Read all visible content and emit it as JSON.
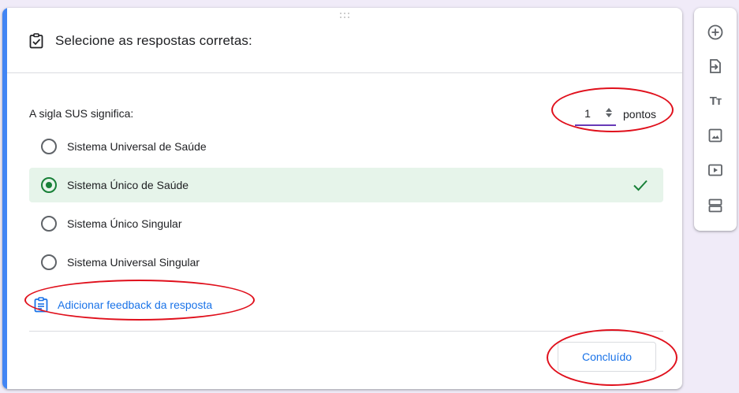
{
  "question_card": {
    "title": "Selecione as respostas corretas:",
    "question": "A sigla SUS significa:",
    "points": {
      "value": "1",
      "label": "pontos"
    },
    "options": [
      {
        "label": "Sistema Universal de Saúde",
        "selected": false,
        "correct": false
      },
      {
        "label": "Sistema Único de Saúde",
        "selected": true,
        "correct": true
      },
      {
        "label": "Sistema Único Singular",
        "selected": false,
        "correct": false
      },
      {
        "label": "Sistema Universal Singular",
        "selected": false,
        "correct": false
      }
    ],
    "feedback_link": "Adicionar feedback da resposta",
    "done_button": "Concluído"
  },
  "side_toolbar": {
    "tools": [
      {
        "icon": "add-circle-icon"
      },
      {
        "icon": "import-questions-icon"
      },
      {
        "icon": "title-text-icon",
        "text": "Tт"
      },
      {
        "icon": "image-icon"
      },
      {
        "icon": "video-icon"
      },
      {
        "icon": "section-icon"
      }
    ]
  },
  "colors": {
    "accent_bar": "#4285f4",
    "correct_bg": "#e6f4ea",
    "correct_green": "#188038",
    "link_blue": "#1a73e8",
    "points_underline": "#673ab7",
    "annotation_red": "#e0101c",
    "page_bg": "#f0ebf8"
  }
}
